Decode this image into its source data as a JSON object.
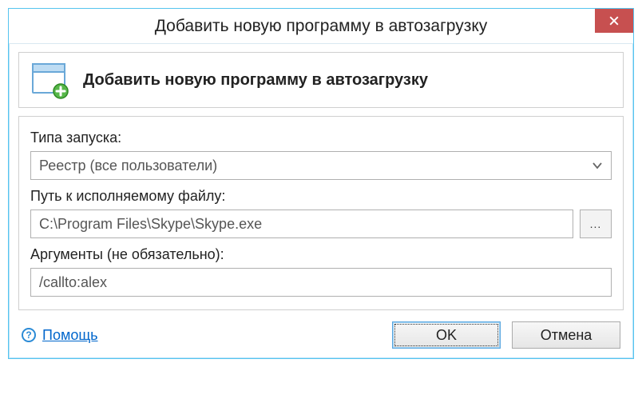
{
  "window": {
    "title": "Добавить новую программу в автозагрузку"
  },
  "header": {
    "title": "Добавить новую программу в автозагрузку"
  },
  "form": {
    "launch_type_label": "Типа запуска:",
    "launch_type_value": "Реестр (все пользователи)",
    "path_label": "Путь к исполняемому файлу:",
    "path_value": "C:\\Program Files\\Skype\\Skype.exe",
    "browse_label": "...",
    "args_label": "Аргументы (не обязательно):",
    "args_value": "/callto:alex"
  },
  "footer": {
    "help_label": "Помощь",
    "ok_label": "OK",
    "cancel_label": "Отмена"
  }
}
